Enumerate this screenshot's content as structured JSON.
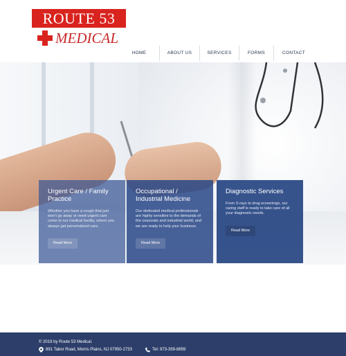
{
  "logo": {
    "top_text": "ROUTE 53",
    "bottom_text": "MEDICAL"
  },
  "nav": {
    "items": [
      {
        "label": "HOME"
      },
      {
        "label": "ABOUT US"
      },
      {
        "label": "SERVICES"
      },
      {
        "label": "FORMS"
      },
      {
        "label": "CONTACT"
      }
    ]
  },
  "cards": [
    {
      "title": "Urgent Care / Family Practice",
      "body": "Whether you have a cough that just won't go away or need urgent care come to our medical facility, where you always get personalized care.",
      "button": "Read More"
    },
    {
      "title": "Occupational / Industrial Medicine",
      "body": "Our dedicated medical professionals are highly sensitive to the demands of the corporate and industrial world, and we are ready to help your business.",
      "button": "Read More"
    },
    {
      "title": "Diagnostic Services",
      "body": "From X-rays to drug screenings, our caring staff is ready to take care of all your diagnostic needs.",
      "button": "Read More"
    }
  ],
  "footer": {
    "copyright": "© 2019 by Route 53 Medical.",
    "address": "891 Tabor Road, Morris Plains, NJ 07950-2733",
    "phone": "Tel: 973-359-8859"
  },
  "colors": {
    "brand_red": "#d9231e",
    "nav_text": "#24344f",
    "card_blue": "#2a4888",
    "footer_bg": "#2c3e69"
  },
  "icons": {
    "logo": "red-cross-icon",
    "address": "location-pin-icon",
    "phone": "phone-icon"
  }
}
